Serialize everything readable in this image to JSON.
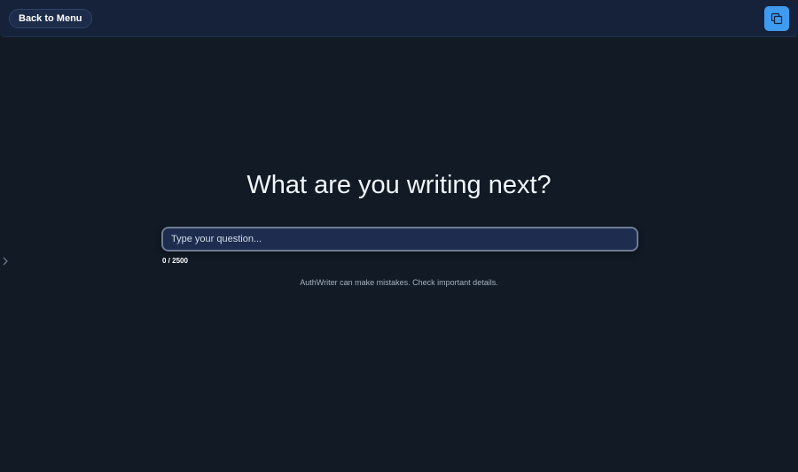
{
  "header": {
    "back_label": "Back to Menu",
    "action_icon": "copy-windows-icon"
  },
  "sidebar": {
    "toggle_icon": "chevron-right-icon"
  },
  "main": {
    "heading": "What are you writing next?",
    "input": {
      "value": "",
      "placeholder": "Type your question..."
    },
    "counter": "0 / 2500",
    "disclaimer": "AuthWriter can make mistakes. Check important details."
  },
  "colors": {
    "background": "#111a25",
    "header": "#16223a",
    "accent": "#3f9bf0",
    "input_bg": "#1d2c4f"
  }
}
